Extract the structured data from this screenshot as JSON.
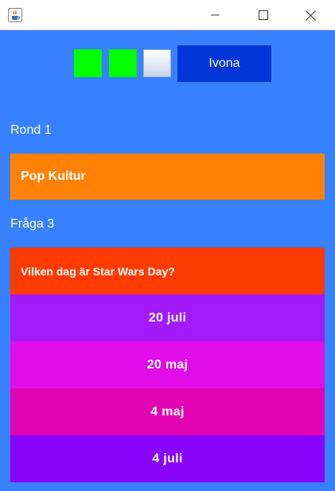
{
  "window": {
    "app_icon": "java-cup-icon",
    "minimize_icon": "minimize-icon",
    "maximize_icon": "maximize-icon",
    "close_icon": "close-icon"
  },
  "scoreboard": {
    "boxes": [
      {
        "state": "correct",
        "color": "#00ff00"
      },
      {
        "state": "correct",
        "color": "#00ff00"
      },
      {
        "state": "pending",
        "color": "#e8eef6"
      }
    ],
    "player_name": "Ivona",
    "player_color": "#0236d9"
  },
  "round": {
    "label": "Rond 1",
    "category": "Pop Kultur",
    "category_color": "#ff8204"
  },
  "question": {
    "label": "Fråga 3",
    "text": "Vilken dag är Star Wars Day?",
    "color": "#ff3a02"
  },
  "answers": [
    {
      "label": "20 juli",
      "color": "#a31bfb"
    },
    {
      "label": "20 maj",
      "color": "#e20ce9"
    },
    {
      "label": "4 maj",
      "color": "#e203b2"
    },
    {
      "label": "4 juli",
      "color": "#8804fd"
    }
  ],
  "background_color": "#3781ff"
}
